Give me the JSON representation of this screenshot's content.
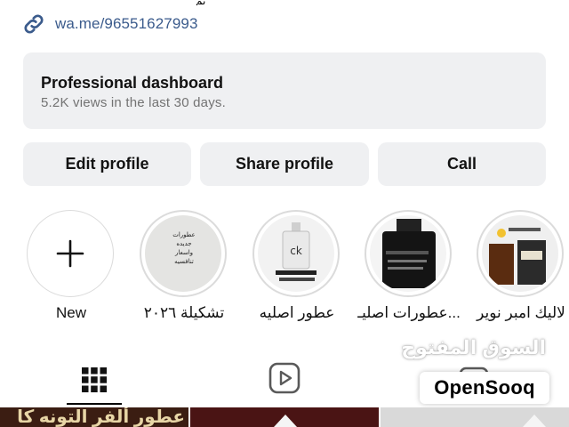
{
  "profile": {
    "top_cut_text": "يم",
    "link": "wa.me/96551627993"
  },
  "dashboard": {
    "title": "Professional dashboard",
    "subtitle": "5.2K views in the last 30 days."
  },
  "buttons": {
    "edit": "Edit profile",
    "share": "Share profile",
    "call": "Call"
  },
  "highlights": [
    {
      "label": "New",
      "icon": "plus-icon"
    },
    {
      "label": "تشكيلة ٢٠٢٦",
      "thumb_text": "عطورات جديده واسعار تنافسيه"
    },
    {
      "label": "عطور اصليه",
      "thumb_text": "CK"
    },
    {
      "label": "عطورات اصليـ...",
      "thumb_text": ""
    },
    {
      "label": "لاليك امبر نوير",
      "thumb_text": "LALIQUE"
    }
  ],
  "tabs": [
    {
      "name": "posts-grid",
      "icon": "grid-icon",
      "active": true
    },
    {
      "name": "reels",
      "icon": "reels-icon",
      "active": false
    },
    {
      "name": "tagged",
      "icon": "tagged-icon",
      "active": false
    }
  ],
  "watermark": {
    "arabic": "السوق المفتوح",
    "brand": "OpenSooq"
  },
  "grid_preview": {
    "cell_1_text": "عطور ألفر التونه كا"
  },
  "colors": {
    "link": "#3b5b8c",
    "card_bg": "#eff0f2",
    "muted_text": "#737373"
  }
}
